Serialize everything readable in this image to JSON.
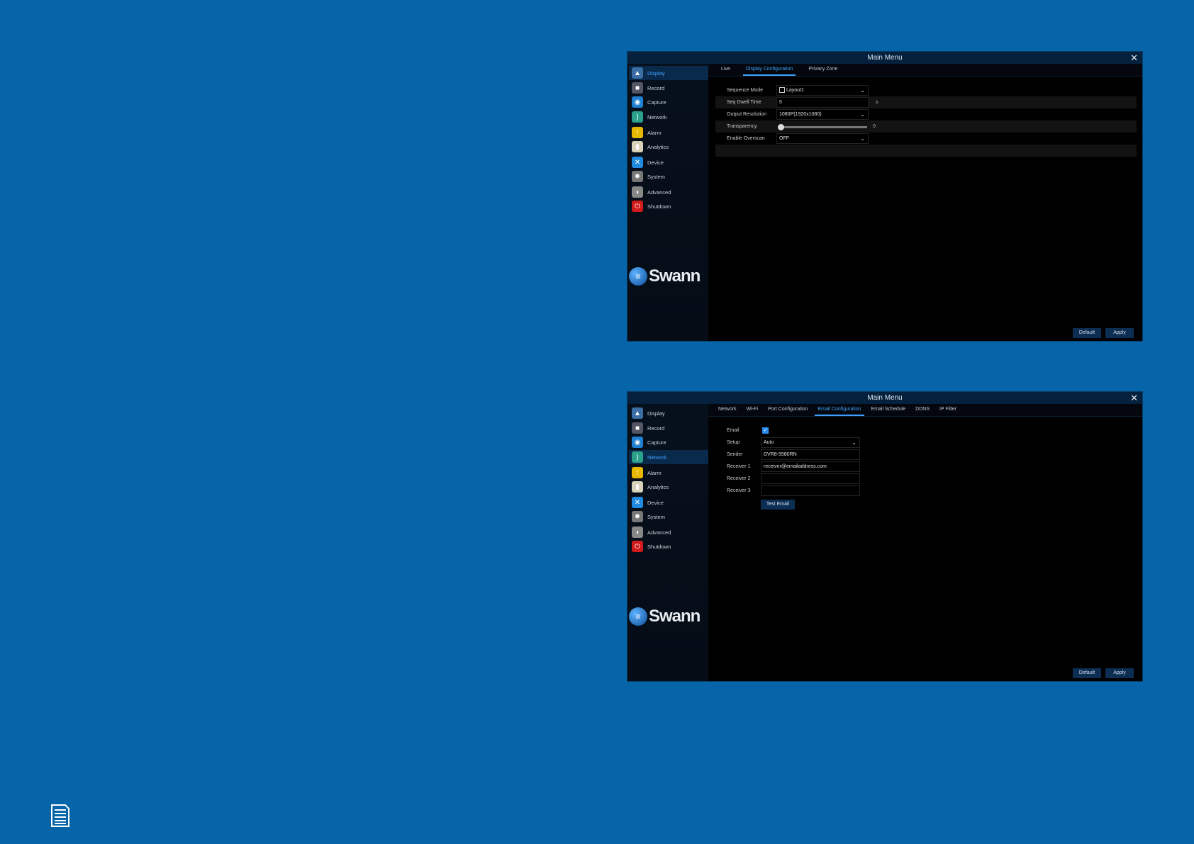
{
  "sidebar": {
    "items": [
      {
        "label": "Display",
        "icon": "display-icon"
      },
      {
        "label": "Record",
        "icon": "record-icon"
      },
      {
        "label": "Capture",
        "icon": "camera-icon"
      },
      {
        "label": "Network",
        "icon": "network-icon"
      },
      {
        "label": "Alarm",
        "icon": "alarm-icon"
      },
      {
        "label": "Analytics",
        "icon": "analytics-icon"
      },
      {
        "label": "Device",
        "icon": "device-icon"
      },
      {
        "label": "System",
        "icon": "gear-icon"
      },
      {
        "label": "Advanced",
        "icon": "mouse-icon"
      },
      {
        "label": "Shutdown",
        "icon": "power-icon"
      }
    ],
    "logo": "Swann"
  },
  "panel1": {
    "title": "Main Menu",
    "tabs": [
      "Live",
      "Display Configuration",
      "Privacy Zone"
    ],
    "sequence_mode_label": "Sequence Mode",
    "sequence_mode_value": "Layout1",
    "dwell_label": "Seq Dwell Time",
    "dwell_value": "5",
    "dwell_unit": "s",
    "resolution_label": "Output Resolution",
    "resolution_value": "1080P(1920x1080)",
    "transparency_label": "Transparency",
    "transparency_value": "0",
    "overscan_label": "Enable Overscan",
    "overscan_value": "OFF",
    "default_label": "Default",
    "apply_label": "Apply"
  },
  "panel2": {
    "title": "Main Menu",
    "tabs": [
      "Network",
      "Wi-Fi",
      "Port Configuration",
      "Email Configuration",
      "Email Schedule",
      "DDNS",
      "IP Filter"
    ],
    "email_label": "Email",
    "email_enabled": true,
    "setup_label": "Setup",
    "setup_value": "Auto",
    "sender_label": "Sender",
    "sender_value": "DVR8-5580RN",
    "receiver1_label": "Receiver 1",
    "receiver1_value": "receiver@emailaddress.com",
    "receiver2_label": "Receiver 2",
    "receiver2_value": "",
    "receiver3_label": "Receiver 3",
    "receiver3_value": "",
    "test_label": "Test Email",
    "default_label": "Default",
    "apply_label": "Apply"
  },
  "colors": {
    "background": "#0565a8",
    "accent": "#3fa0ff",
    "titlebar": "#05213d"
  }
}
